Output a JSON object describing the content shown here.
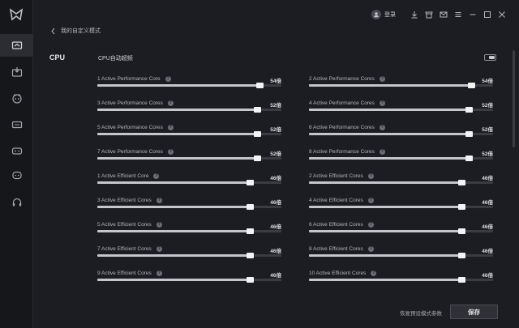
{
  "topbar": {
    "login_label": "登录"
  },
  "breadcrumb": {
    "title": "我的自定义模式"
  },
  "cpu": {
    "section_title": "CPU",
    "auto_label": "CPU自动超频",
    "sliders": [
      {
        "label": "1 Active Performance Core",
        "value_text": "54倍",
        "level_percent": 88
      },
      {
        "label": "2 Active Performance Cores",
        "value_text": "54倍",
        "level_percent": 88
      },
      {
        "label": "3 Active Performance Cores",
        "value_text": "52倍",
        "level_percent": 87
      },
      {
        "label": "4 Active Performance Cores",
        "value_text": "52倍",
        "level_percent": 87
      },
      {
        "label": "5 Active Performance Cores",
        "value_text": "52倍",
        "level_percent": 87
      },
      {
        "label": "6 Active Performance Cores",
        "value_text": "52倍",
        "level_percent": 87
      },
      {
        "label": "7 Active Performance Cores",
        "value_text": "52倍",
        "level_percent": 87
      },
      {
        "label": "8 Active Performance Cores",
        "value_text": "52倍",
        "level_percent": 87
      },
      {
        "label": "1 Active Efficient Core",
        "value_text": "46倍",
        "level_percent": 83
      },
      {
        "label": "2 Active Efficient Cores",
        "value_text": "46倍",
        "level_percent": 83
      },
      {
        "label": "3 Active Efficient Cores",
        "value_text": "46倍",
        "level_percent": 83
      },
      {
        "label": "4 Active Efficient Cores",
        "value_text": "46倍",
        "level_percent": 83
      },
      {
        "label": "5 Active Efficient Cores",
        "value_text": "46倍",
        "level_percent": 83
      },
      {
        "label": "6 Active Efficient Cores",
        "value_text": "46倍",
        "level_percent": 83
      },
      {
        "label": "7 Active Efficient Cores",
        "value_text": "46倍",
        "level_percent": 83
      },
      {
        "label": "8 Active Efficient Cores",
        "value_text": "46倍",
        "level_percent": 83
      },
      {
        "label": "9 Active Efficient Cores",
        "value_text": "46倍",
        "level_percent": 83
      },
      {
        "label": "10 Active Efficient Cores",
        "value_text": "46倍",
        "level_percent": 83
      }
    ]
  },
  "footer": {
    "restore_label": "恢复预设模式参数",
    "save_label": "保存"
  },
  "colors": {
    "background": "#1c1d22",
    "sidebar": "#16171b",
    "track": "#3a3c42",
    "fill": "#c4c6cb"
  },
  "sidebar_icons": [
    "home-icon",
    "download-monitor-icon",
    "character-icon",
    "keyboard-icon",
    "gamepad-icon",
    "chat-bubble-icon",
    "headset-icon"
  ]
}
